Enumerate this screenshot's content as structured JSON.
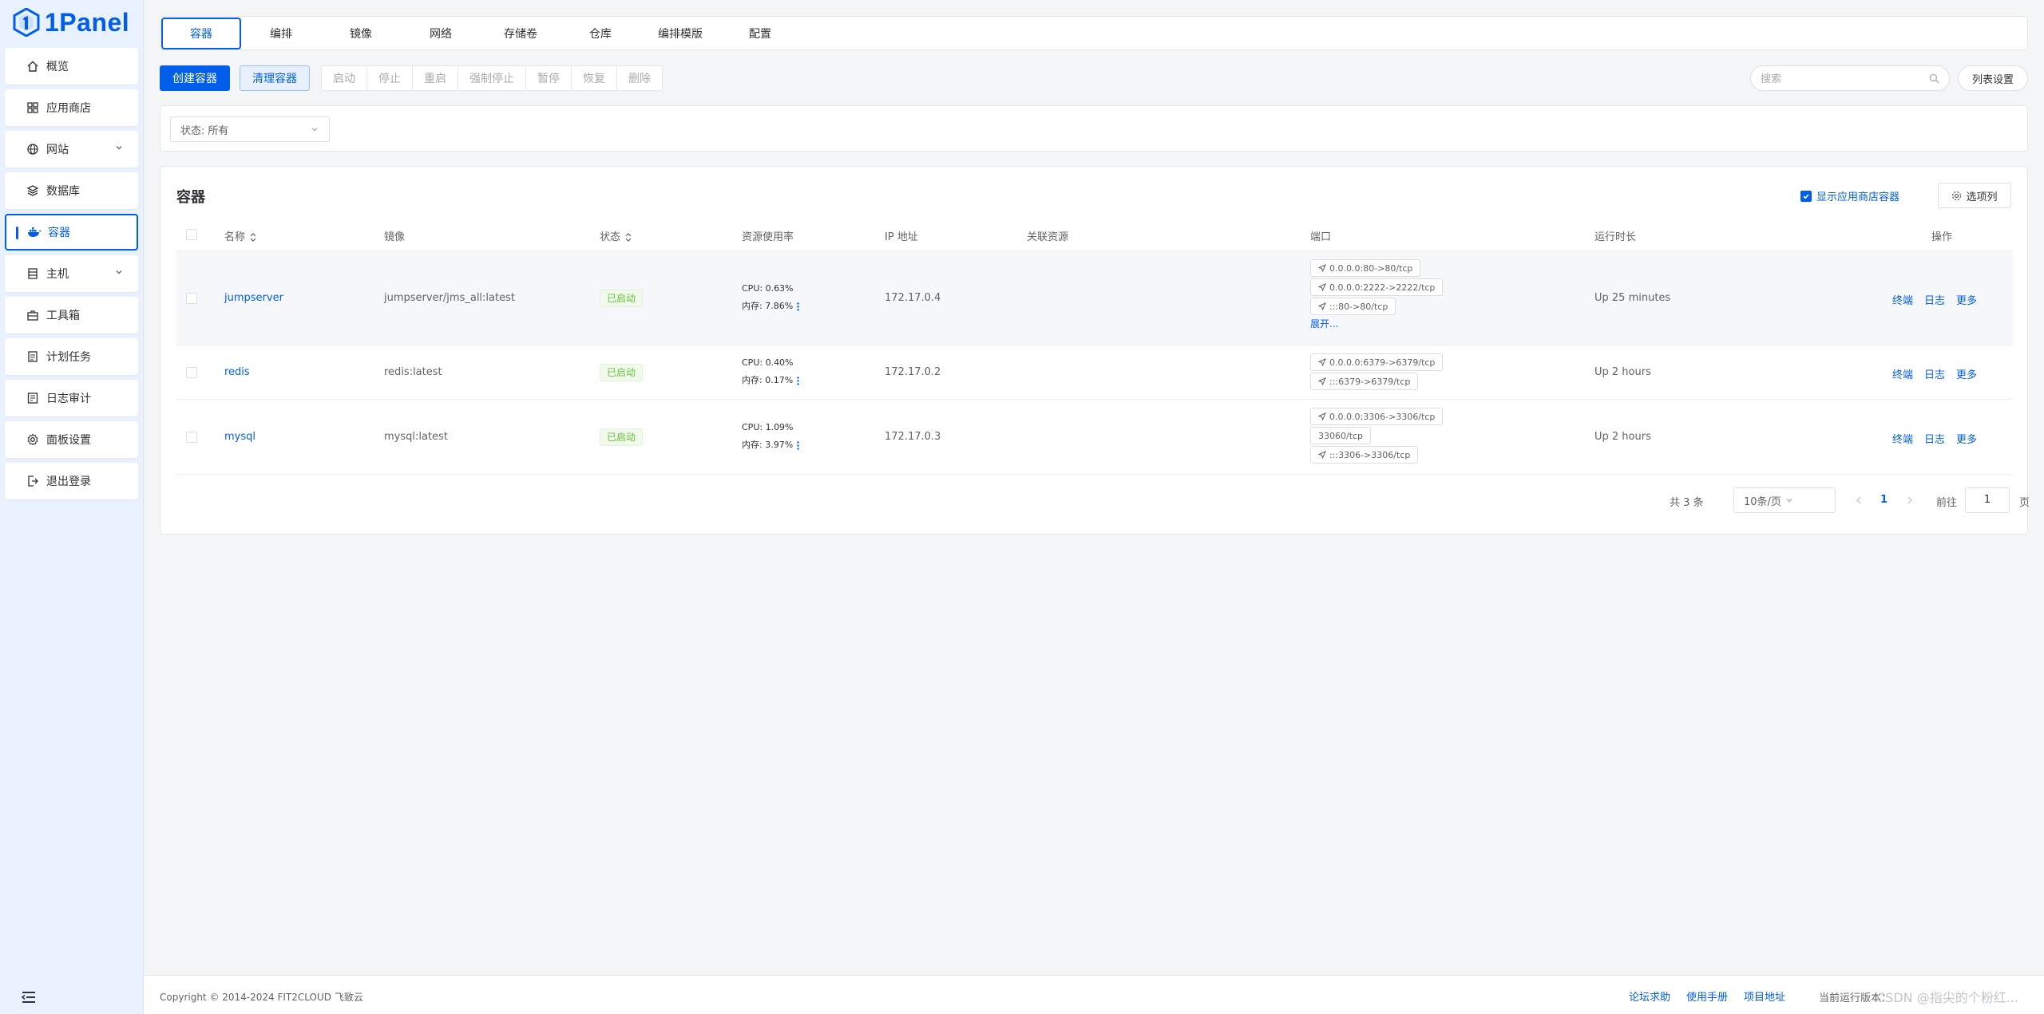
{
  "app": {
    "name": "1Panel",
    "accent": "#005eeb"
  },
  "sidebar": {
    "items": [
      {
        "label": "概览",
        "icon": "home-icon"
      },
      {
        "label": "应用商店",
        "icon": "grid-icon"
      },
      {
        "label": "网站",
        "icon": "globe-icon"
      },
      {
        "label": "数据库",
        "icon": "layers-icon"
      },
      {
        "label": "容器",
        "icon": "docker-icon"
      },
      {
        "label": "主机",
        "icon": "server-icon"
      },
      {
        "label": "工具箱",
        "icon": "toolbox-icon"
      },
      {
        "label": "计划任务",
        "icon": "calendar-icon"
      },
      {
        "label": "日志审计",
        "icon": "log-icon"
      },
      {
        "label": "面板设置",
        "icon": "gear-icon"
      },
      {
        "label": "退出登录",
        "icon": "logout-icon"
      }
    ],
    "active": "容器"
  },
  "tabs": [
    "容器",
    "编排",
    "镜像",
    "网络",
    "存储卷",
    "仓库",
    "编排模版",
    "配置"
  ],
  "toolbar": {
    "create": "创建容器",
    "prune": "清理容器",
    "actions": [
      "启动",
      "停止",
      "重启",
      "强制停止",
      "暂停",
      "恢复",
      "删除"
    ],
    "search_placeholder": "搜索",
    "list_settings": "列表设置"
  },
  "filter": {
    "status_label": "状态:",
    "status_value": "所有"
  },
  "panel": {
    "title": "容器",
    "show_store": "显示应用商店容器",
    "columns_btn": "选项列"
  },
  "table": {
    "headers": {
      "name": "名称",
      "image": "镜像",
      "status": "状态",
      "resource": "资源使用率",
      "ip": "IP 地址",
      "related": "关联资源",
      "ports": "端口",
      "uptime": "运行时长",
      "ops": "操作"
    },
    "rows": [
      {
        "name": "jumpserver",
        "image": "jumpserver/jms_all:latest",
        "status": "已启动",
        "cpu": "CPU: 0.63%",
        "mem": "内存: 7.86%",
        "ip": "172.17.0.4",
        "ports": [
          "0.0.0.0:80->80/tcp",
          "0.0.0.0:2222->2222/tcp",
          ":::80->80/tcp"
        ],
        "expand": "展开...",
        "uptime": "Up 25 minutes"
      },
      {
        "name": "redis",
        "image": "redis:latest",
        "status": "已启动",
        "cpu": "CPU: 0.40%",
        "mem": "内存: 0.17%",
        "ip": "172.17.0.2",
        "ports": [
          "0.0.0.0:6379->6379/tcp",
          ":::6379->6379/tcp"
        ],
        "uptime": "Up 2 hours"
      },
      {
        "name": "mysql",
        "image": "mysql:latest",
        "status": "已启动",
        "cpu": "CPU: 1.09%",
        "mem": "内存: 3.97%",
        "ip": "172.17.0.3",
        "ports": [
          "0.0.0.0:3306->3306/tcp",
          "33060/tcp",
          ":::3306->3306/tcp"
        ],
        "uptime": "Up 2 hours"
      }
    ],
    "ops": [
      "终端",
      "日志",
      "更多"
    ]
  },
  "pagination": {
    "total": "共 3 条",
    "page_size": "10条/页",
    "current": "1",
    "goto_label": "前往",
    "goto_value": "1",
    "page_suffix": "页"
  },
  "footer": {
    "copyright": "Copyright © 2014-2024 FIT2CLOUD 飞致云",
    "links": [
      "论坛求助",
      "使用手册",
      "项目地址"
    ],
    "version_label": "当前运行版本：",
    "watermark": "CSDN @指尖的个粉红..."
  }
}
